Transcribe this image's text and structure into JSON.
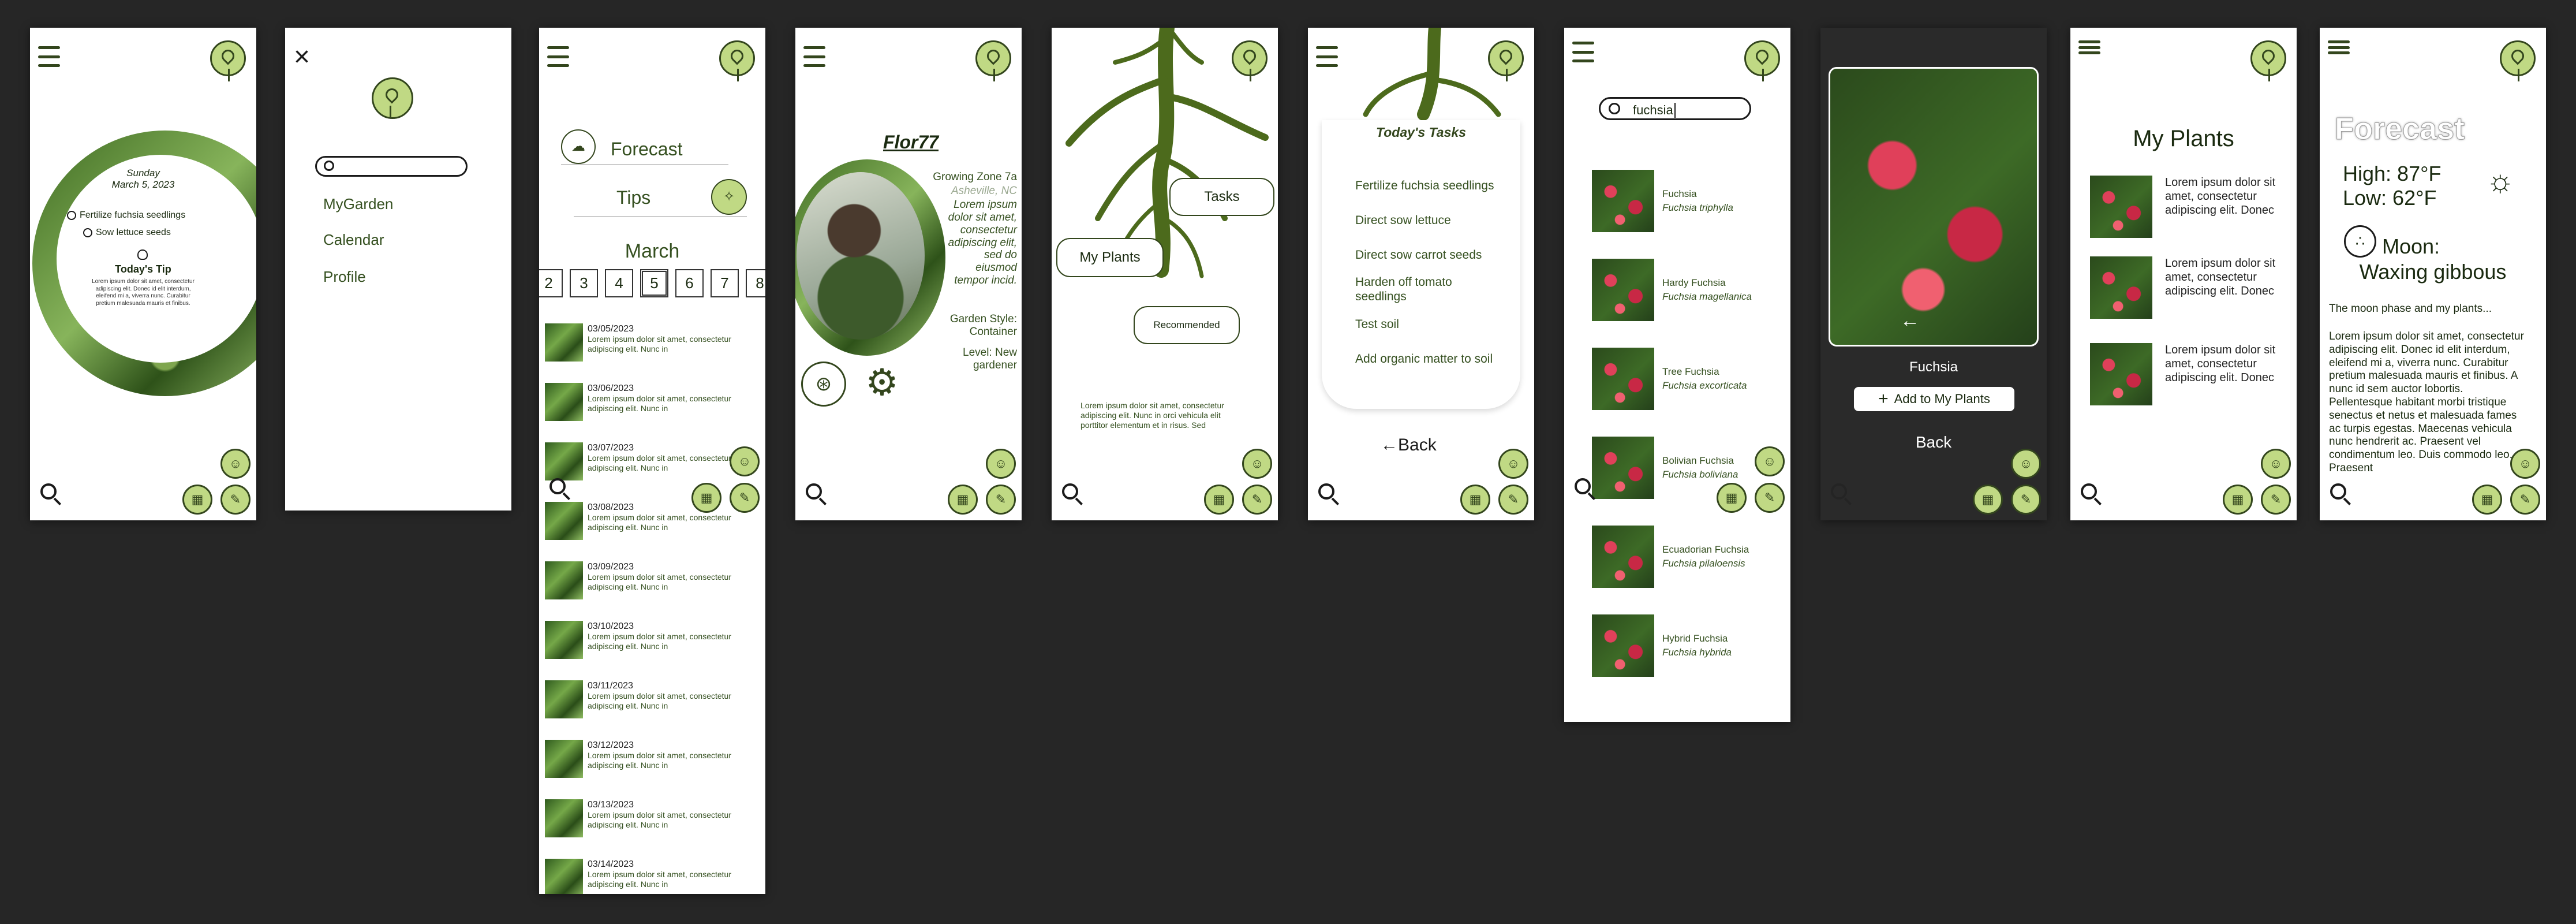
{
  "home": {
    "day": "Sunday",
    "date": "March 5, 2023",
    "tasks": [
      "Fertilize fuchsia seedlings",
      "Sow lettuce seeds"
    ],
    "tip_title": "Today's Tip",
    "tip_text": "Lorem ipsum dolor sit amet, consectetur adipiscing elit. Donec id elit interdum, eleifend mi a, viverra nunc. Curabitur pretium malesuada mauris et finibus."
  },
  "menu": {
    "close_icon": "close-icon",
    "search_placeholder": "",
    "items": [
      "MyGarden",
      "Calendar",
      "Profile"
    ]
  },
  "calendar": {
    "forecast_label": "Forecast",
    "tips_label": "Tips",
    "month": "March",
    "days": [
      "2",
      "3",
      "4",
      "5",
      "6",
      "7",
      "8"
    ],
    "selected_day": "5",
    "entries": [
      {
        "date": "03/05/2023",
        "text": "Lorem ipsum dolor sit amet, consectetur adipiscing elit. Nunc in"
      },
      {
        "date": "03/06/2023",
        "text": "Lorem ipsum dolor sit amet, consectetur adipiscing elit. Nunc in"
      },
      {
        "date": "03/07/2023",
        "text": "Lorem ipsum dolor sit amet, consectetur adipiscing elit. Nunc in"
      },
      {
        "date": "03/08/2023",
        "text": "Lorem ipsum dolor sit amet, consectetur adipiscing elit. Nunc in"
      },
      {
        "date": "03/09/2023",
        "text": "Lorem ipsum dolor sit amet, consectetur adipiscing elit. Nunc in"
      },
      {
        "date": "03/10/2023",
        "text": "Lorem ipsum dolor sit amet, consectetur adipiscing elit. Nunc in"
      },
      {
        "date": "03/11/2023",
        "text": "Lorem ipsum dolor sit amet, consectetur adipiscing elit. Nunc in"
      },
      {
        "date": "03/12/2023",
        "text": "Lorem ipsum dolor sit amet, consectetur adipiscing elit. Nunc in"
      },
      {
        "date": "03/13/2023",
        "text": "Lorem ipsum dolor sit amet, consectetur adipiscing elit. Nunc in"
      },
      {
        "date": "03/14/2023",
        "text": "Lorem ipsum dolor sit amet, consectetur adipiscing elit. Nunc in"
      }
    ]
  },
  "profile": {
    "username": "Flor77",
    "zone": "Growing Zone 7a",
    "location": "Asheville, NC",
    "bio": "Lorem ipsum dolor sit amet, consectetur adipiscing elit, sed do eiusmod tempor incid.",
    "style": "Garden Style: Container",
    "level": "Level: New gardener"
  },
  "garden": {
    "my_plants_label": "My Plants",
    "tasks_label": "Tasks",
    "recommended_label": "Recommended",
    "text": "Lorem ipsum dolor sit amet, consectetur adipiscing elit. Nunc in orci vehicula elit porttitor elementum et in risus. Sed"
  },
  "tasks": {
    "title": "Today's Tasks",
    "items": [
      "Fertilize fuchsia seedlings",
      "Direct sow lettuce",
      "Direct sow carrot seeds",
      "Harden off tomato seedlings",
      "Test soil",
      "Add organic matter to soil"
    ],
    "back_label": "Back"
  },
  "search": {
    "query": "fuchsia",
    "results": [
      {
        "name": "Fuchsia",
        "latin": "Fuchsia triphylla"
      },
      {
        "name": "Hardy Fuchsia",
        "latin": "Fuchsia magellanica"
      },
      {
        "name": "Tree Fuchsia",
        "latin": "Fuchsia excorticata"
      },
      {
        "name": "Bolivian Fuchsia",
        "latin": "Fuchsia boliviana"
      },
      {
        "name": "Ecuadorian Fuchsia",
        "latin": "Fuchsia pilaloensis"
      },
      {
        "name": "Hybrid Fuchsia",
        "latin": "Fuchsia hybrida"
      }
    ]
  },
  "detail": {
    "plant_name": "Fuchsia",
    "add_label": "Add to My Plants",
    "back_label": "Back"
  },
  "myplants": {
    "title": "My Plants",
    "item_text": "Lorem ipsum dolor sit amet, consectetur adipiscing elit. Donec"
  },
  "weather": {
    "title": "Forecast",
    "high": "High: 87°F",
    "low": "Low: 62°F",
    "moon_label": "Moon:",
    "moon_phase": "Waxing gibbous",
    "intro": "The moon phase and my plants...",
    "body": "Lorem ipsum dolor sit amet, consectetur adipiscing elit. Donec id elit interdum, eleifend mi a, viverra nunc. Curabitur pretium malesuada mauris et finibus. A nunc id sem auctor lobortis. Pellentesque habitant morbi tristique senectus et netus et malesuada fames ac turpis egestas. Maecenas vehicula nunc hendrerit ac. Praesent vel condimentum leo. Duis commodo leo. Praesent"
  },
  "colors": {
    "accent": "#c0d984",
    "dark_green": "#33461d",
    "text_green": "#355020",
    "background": "#262626"
  }
}
